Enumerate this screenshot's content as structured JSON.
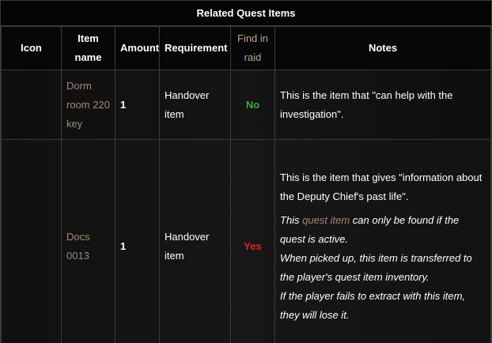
{
  "table": {
    "title": "Related Quest Items",
    "headers": {
      "icon": "Icon",
      "item_name_line1": "Item",
      "item_name_line2": "name",
      "amount": "Amount",
      "requirement": "Requirement",
      "find_in_raid_line1": "Find in",
      "find_in_raid_line2": "raid",
      "notes": "Notes"
    },
    "rows": [
      {
        "icon": "",
        "item_name": "Dorm room 220 key",
        "amount": "1",
        "requirement": "Handover item",
        "find_in_raid": "No",
        "notes": {
          "main": "This is the item that \"can help with the investigation\"."
        }
      },
      {
        "icon": "",
        "item_name": "Docs 0013",
        "amount": "1",
        "requirement": "Handover item",
        "find_in_raid": "Yes",
        "notes": {
          "main": "This is the item that gives \"information about the Deputy Chief's past life\".",
          "italic_prefix": "This ",
          "link": "quest item",
          "italic_suffix": " can only be found if the quest is active.",
          "line2": "When picked up, this item is transferred to the player's quest item inventory.",
          "line3": "If the player fails to extract with this item, they will lose it."
        }
      }
    ]
  },
  "colors": {
    "muted_link": "#9c8c72",
    "no_green": "#3fa83f",
    "yes_red": "#e02424",
    "border": "#3a3a3a"
  }
}
